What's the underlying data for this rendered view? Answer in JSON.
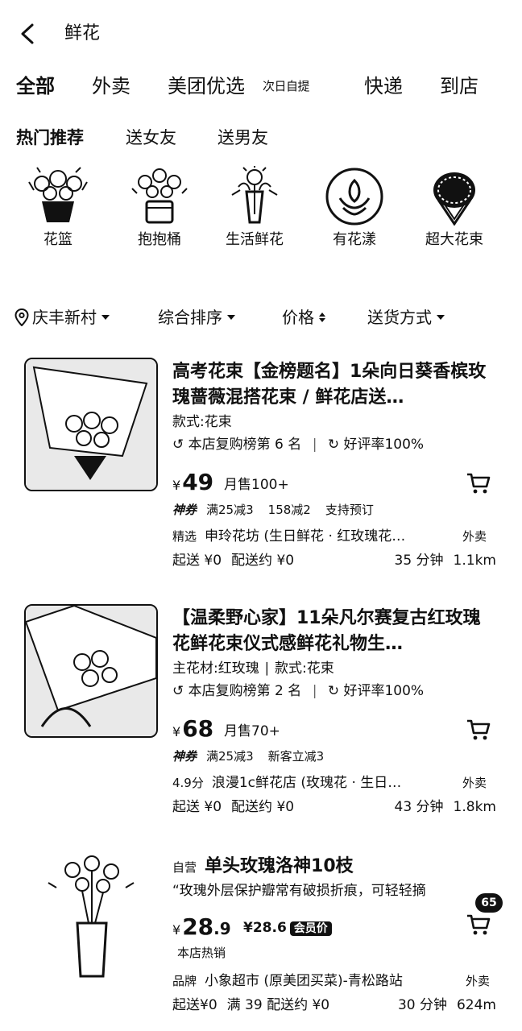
{
  "header": {
    "title": "鲜花"
  },
  "tabs": [
    "全部",
    "外卖",
    "美团优选",
    "次日自提",
    "快递",
    "到店"
  ],
  "subtabs": [
    "热门推荐",
    "送女友",
    "送男友"
  ],
  "categories": [
    "花篮",
    "抱抱桶",
    "生活鲜花",
    "有花漾",
    "超大花束"
  ],
  "filters": [
    "庆丰新村",
    "综合排序",
    "价格",
    "送货方式"
  ],
  "products": [
    {
      "title": "高考花束【金榜题名】1朵向日葵香槟玫瑰蔷薇混搭花束 / 鲜花店送…",
      "attrs": "款式:花束",
      "rank": "本店复购榜第 6 名",
      "rating": "好评率100%",
      "currency": "¥",
      "price": "49",
      "sold": "月售100+",
      "promo_label": "神券",
      "promos": [
        "满25减3",
        "158减2",
        "支持预订"
      ],
      "shop_tag": "精选",
      "shop": "申玲花坊 (生日鲜花 · 红玫瑰花…",
      "channel": "外卖",
      "min_order": "起送 ¥0",
      "delivery_fee": "配送约 ¥0",
      "time": "35 分钟",
      "distance": "1.1km"
    },
    {
      "title": "【温柔野心家】11朵凡尔赛复古红玫瑰花鲜花束仪式感鲜花礼物生…",
      "attrs": "主花材:红玫瑰 ∣ 款式:花束",
      "rank": "本店复购榜第 2 名",
      "rating": "好评率100%",
      "currency": "¥",
      "price": "68",
      "sold": "月售70+",
      "promo_label": "神券",
      "promos": [
        "满25减3",
        "新客立减3"
      ],
      "shop_tag": "4.9分",
      "shop": "浪漫1c鲜花店 (玫瑰花 · 生日…",
      "channel": "外卖",
      "min_order": "起送 ¥0",
      "delivery_fee": "配送约 ¥0",
      "time": "43 分钟",
      "distance": "1.8km"
    },
    {
      "self_tag": "自营",
      "title": "单头玫瑰洛神10枝",
      "desc": "“玫瑰外层保护瓣常有破损折痕，可轻轻摘",
      "currency": "¥",
      "price": "28",
      "price_decimal": ".9",
      "member_price": "¥28.6",
      "member_label": "会员价",
      "hot": "本店热销",
      "badge": "65",
      "shop_tag": "品牌",
      "shop": "小象超市 (原美团买菜)-青松路站",
      "channel": "外卖",
      "min_order": "起送¥0",
      "delivery_fee": "满 39 配送约 ¥0",
      "time": "30 分钟",
      "distance": "624m"
    }
  ]
}
